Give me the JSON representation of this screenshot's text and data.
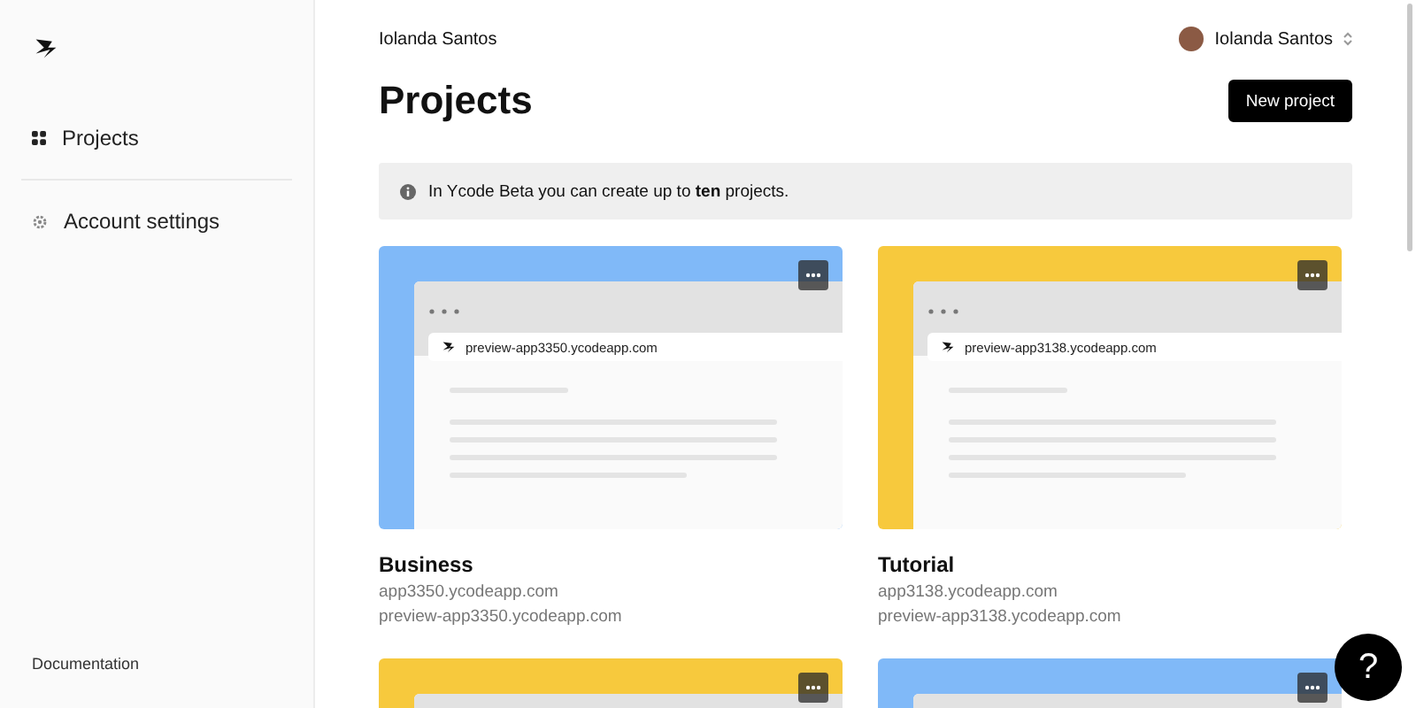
{
  "sidebar": {
    "items": [
      {
        "label": "Projects",
        "kind": "grid"
      },
      {
        "label": "Account settings",
        "kind": "gear"
      }
    ],
    "footer_link": "Documentation"
  },
  "header": {
    "workspace": "Iolanda Santos",
    "user": "Iolanda Santos"
  },
  "page": {
    "title": "Projects",
    "button": "New project",
    "notice": "In Ycode Beta you can create up to **ten** projects."
  },
  "projects": [
    {
      "name": "Business",
      "color": "#80b9f8",
      "preview_url": "preview-app3350.ycodeapp.com",
      "url": "app3350.ycodeapp.com",
      "preview": "preview-app3350.ycodeapp.com"
    },
    {
      "name": "Tutorial",
      "color": "#f7c93d",
      "preview_url": "preview-app3138.ycodeapp.com",
      "url": "app3138.ycodeapp.com",
      "preview": "preview-app3138.ycodeapp.com"
    },
    {
      "color": "#f7c93d"
    },
    {
      "color": "#80b9f8"
    }
  ],
  "help": "?"
}
